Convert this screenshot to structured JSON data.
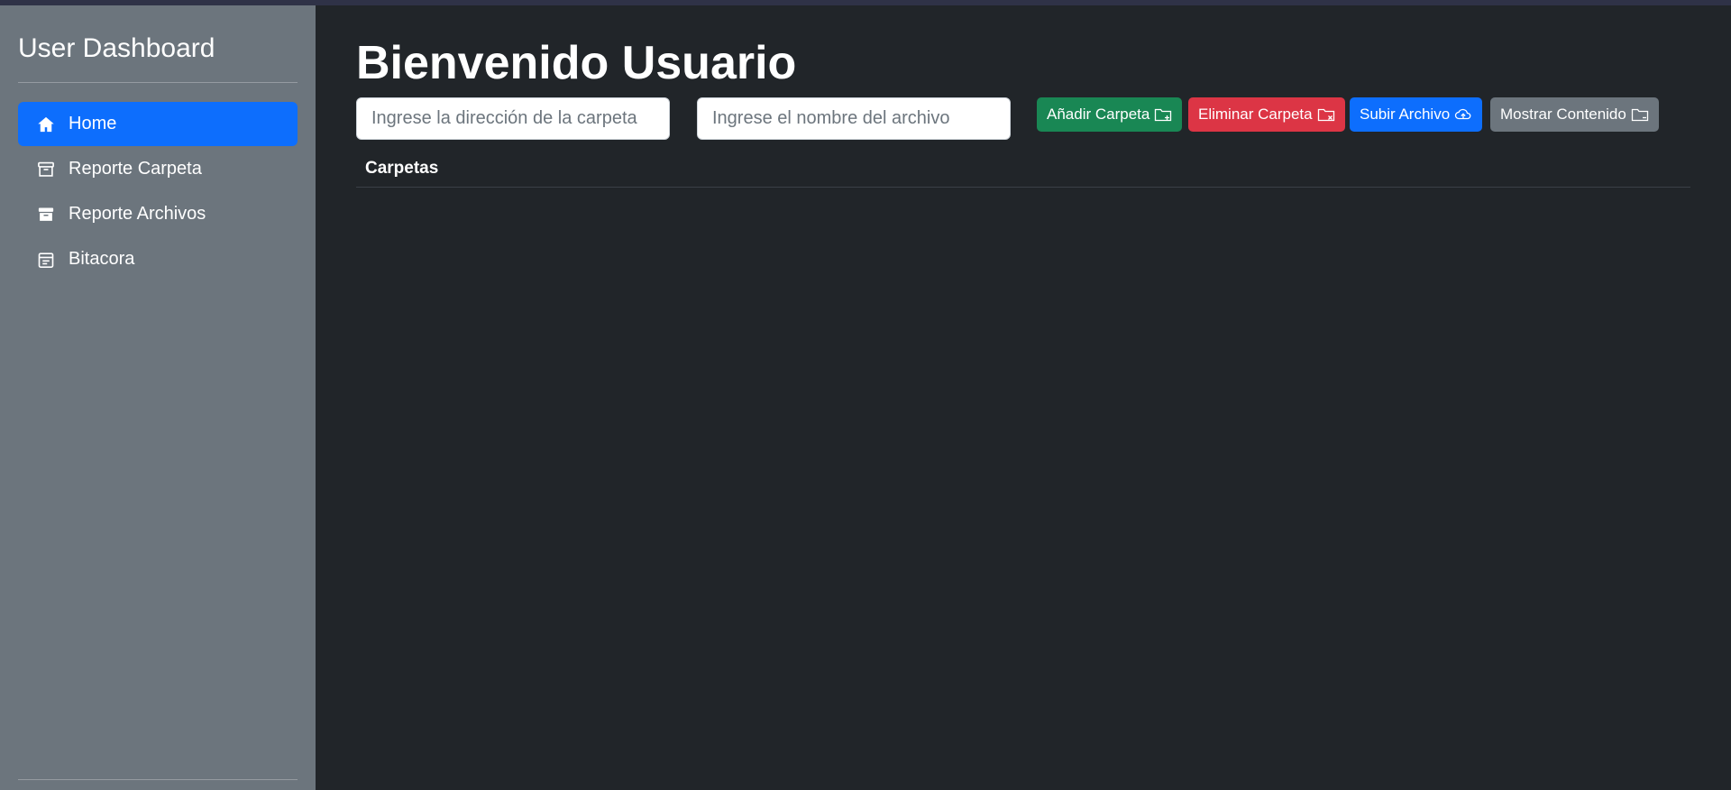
{
  "sidebar": {
    "brand": "User Dashboard",
    "items": [
      {
        "label": "Home",
        "icon": "house-icon",
        "active": true
      },
      {
        "label": "Reporte Carpeta",
        "icon": "archive-icon",
        "active": false
      },
      {
        "label": "Reporte Archivos",
        "icon": "archive-fill-icon",
        "active": false
      },
      {
        "label": "Bitacora",
        "icon": "calendar-icon",
        "active": false
      }
    ]
  },
  "main": {
    "title": "Bienvenido Usuario",
    "folder_input": {
      "placeholder": "Ingrese la dirección de la carpeta",
      "value": ""
    },
    "file_input": {
      "placeholder": "Ingrese el nombre del archivo",
      "value": ""
    },
    "buttons": {
      "add_folder": "Añadir Carpeta",
      "delete_folder": "Eliminar Carpeta",
      "upload_file": "Subir Archivo",
      "show_content": "Mostrar Contenido"
    },
    "table": {
      "header": "Carpetas"
    }
  },
  "colors": {
    "sidebar_bg": "#6c757d",
    "main_bg": "#212529",
    "primary": "#0d6efd",
    "success": "#198754",
    "danger": "#dc3545",
    "secondary": "#6c757d"
  }
}
